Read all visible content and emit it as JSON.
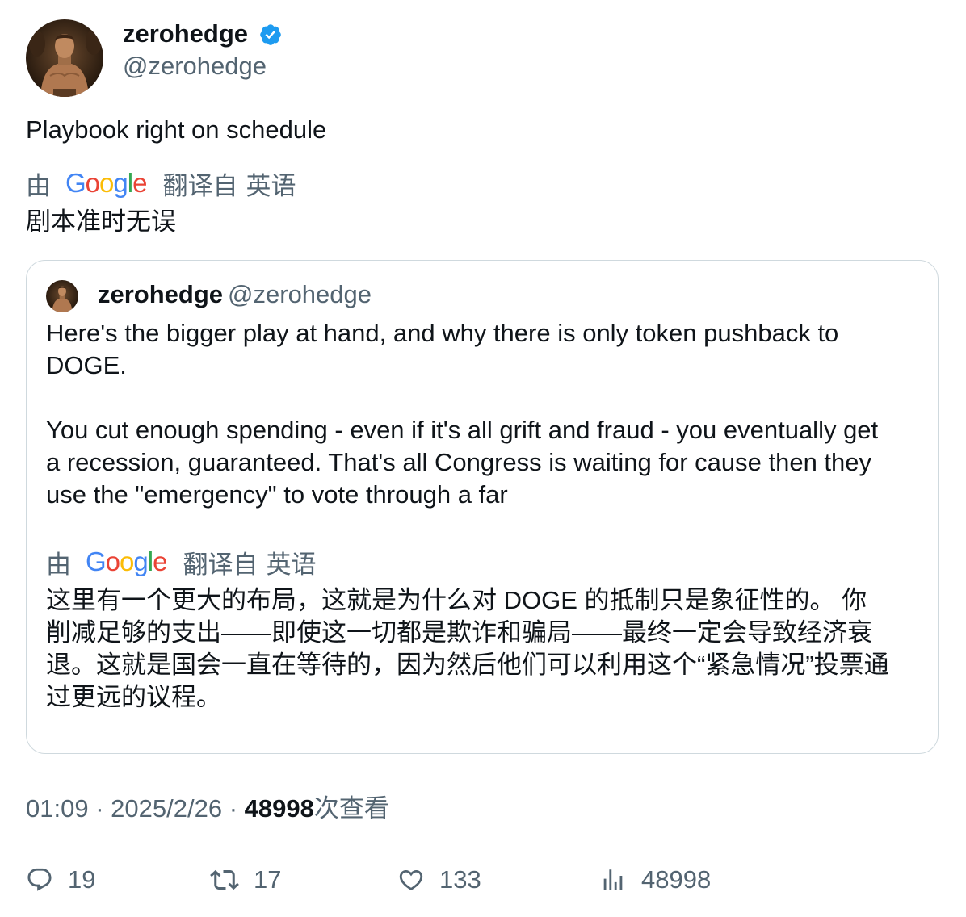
{
  "tweet": {
    "author": {
      "name": "zerohedge",
      "handle": "@zerohedge",
      "verified": true,
      "avatar_icon": "avatar-photo"
    },
    "text": "Playbook right on schedule",
    "translation": {
      "by_label": "由",
      "provider": "Google",
      "provider_letters": [
        "G",
        "o",
        "o",
        "g",
        "l",
        "e"
      ],
      "translated_from_label": "翻译自",
      "source_language": "英语",
      "text": "剧本准时无误"
    },
    "quoted": {
      "author": {
        "name": "zerohedge",
        "handle": "@zerohedge"
      },
      "lines": [
        "Here's the bigger play at hand, and why there is only token pushback to",
        "DOGE.",
        "",
        "You cut enough spending - even if it's all grift and fraud - you eventually get",
        "a recession, guaranteed. That's all Congress is waiting for cause then they",
        "use the \"emergency\" to vote through a far"
      ],
      "translation": {
        "by_label": "由",
        "provider": "Google",
        "translated_from_label": "翻译自",
        "source_language": "英语",
        "lines": [
          "这里有一个更大的布局，这就是为什么对 DOGE 的抵制只是象征性的。 你",
          "削减足够的支出——即使这一切都是欺诈和骗局——最终一定会导致经济衰",
          "退。这就是国会一直在等待的，因为然后他们可以利用这个“紧急情况”投票通",
          "过更远的议程。"
        ]
      }
    },
    "meta": {
      "time": "01:09",
      "separator": "·",
      "date": "2025/2/26",
      "views": "48998",
      "views_label": "次查看"
    },
    "actions": {
      "replies": "19",
      "retweets": "17",
      "likes": "133",
      "views": "48998"
    },
    "colors": {
      "text_primary": "#0f1419",
      "text_secondary": "#536471",
      "border": "#cfd9de",
      "verified": "#1d9bf0",
      "google_blue": "#4285F4",
      "google_red": "#EA4335",
      "google_yellow": "#FBBC05",
      "google_green": "#34A853"
    }
  }
}
